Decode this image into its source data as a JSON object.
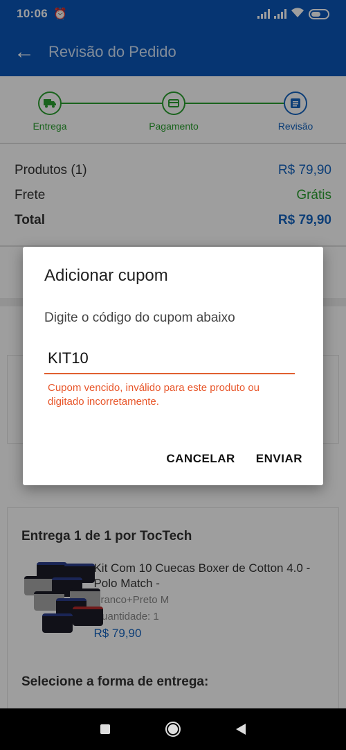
{
  "status_bar": {
    "time": "10:06",
    "alarm_icon": "alarm-icon"
  },
  "app_bar": {
    "title": "Revisão do Pedido"
  },
  "steps": [
    {
      "label": "Entrega",
      "icon": "truck-icon"
    },
    {
      "label": "Pagamento",
      "icon": "card-icon"
    },
    {
      "label": "Revisão",
      "icon": "list-icon"
    }
  ],
  "summary": {
    "products_label": "Produtos (1)",
    "products_value": "R$ 79,90",
    "shipping_label": "Frete",
    "shipping_value": "Grátis",
    "total_label": "Total",
    "total_value": "R$ 79,90"
  },
  "product_card": {
    "delivery_by": "Entrega 1 de 1 por TocTech",
    "product_name": "Kit Com 10 Cuecas Boxer de Cotton 4.0 - Polo Match -",
    "variant": "Branco+Preto M",
    "quantity": "Quantidade:  1",
    "price": "R$ 79,90",
    "select_shipping": "Selecione a forma de entrega:"
  },
  "dialog": {
    "title": "Adicionar cupom",
    "message": "Digite o código do cupom abaixo",
    "input_value": "KIT10",
    "error": "Cupom vencido, inválido para este produto ou digitado incorretamente.",
    "cancel_label": "CANCELAR",
    "submit_label": "ENVIAR"
  },
  "colors": {
    "app_bar": "#0b56b8",
    "step_done": "#2aa12f",
    "accent": "#1565c0",
    "error": "#e8562a"
  }
}
